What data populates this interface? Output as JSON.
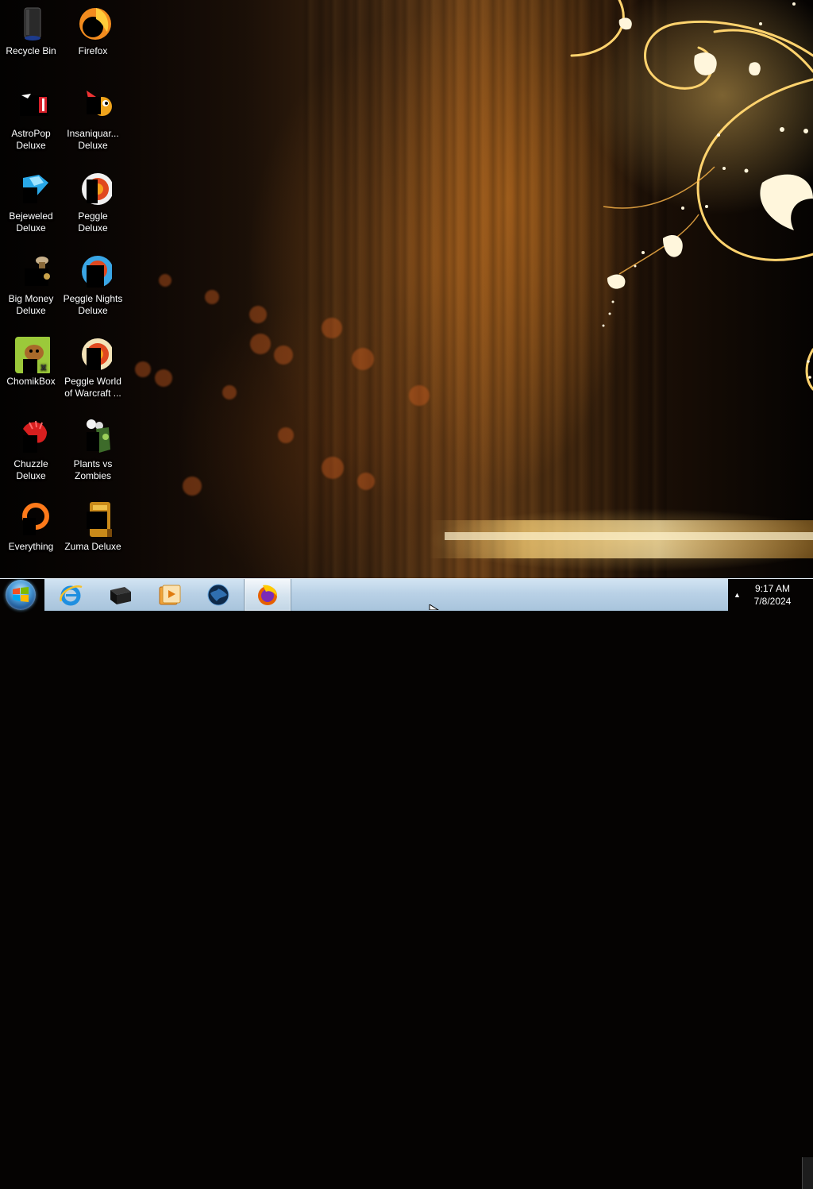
{
  "desktop": {
    "icons": [
      {
        "label": "Recycle Bin"
      },
      {
        "label": "Firefox"
      },
      {
        "label": "AstroPop Deluxe"
      },
      {
        "label": "Insaniquar... Deluxe"
      },
      {
        "label": "Bejeweled Deluxe"
      },
      {
        "label": "Peggle Deluxe"
      },
      {
        "label": "Big Money Deluxe"
      },
      {
        "label": "Peggle Nights Deluxe"
      },
      {
        "label": "ChomikBox"
      },
      {
        "label": "Peggle World of Warcraft ..."
      },
      {
        "label": "Chuzzle Deluxe"
      },
      {
        "label": "Plants vs Zombies"
      },
      {
        "label": "Everything"
      },
      {
        "label": "Zuma Deluxe"
      }
    ]
  },
  "taskbar": {
    "start_icon": "windows-logo-icon",
    "pinned": [
      {
        "name": "internet-explorer-icon"
      },
      {
        "name": "black-box-app-icon"
      },
      {
        "name": "media-player-icon"
      },
      {
        "name": "globe-app-icon"
      },
      {
        "name": "firefox-icon",
        "active": true
      }
    ],
    "tray_arrow": "▲",
    "clock": {
      "time": "9:17 AM",
      "date": "7/8/2024"
    }
  },
  "colors": {
    "taskbar": "#b9d1e6",
    "accent_gold": "#ffd27a",
    "wallpaper_dark": "#050302"
  }
}
